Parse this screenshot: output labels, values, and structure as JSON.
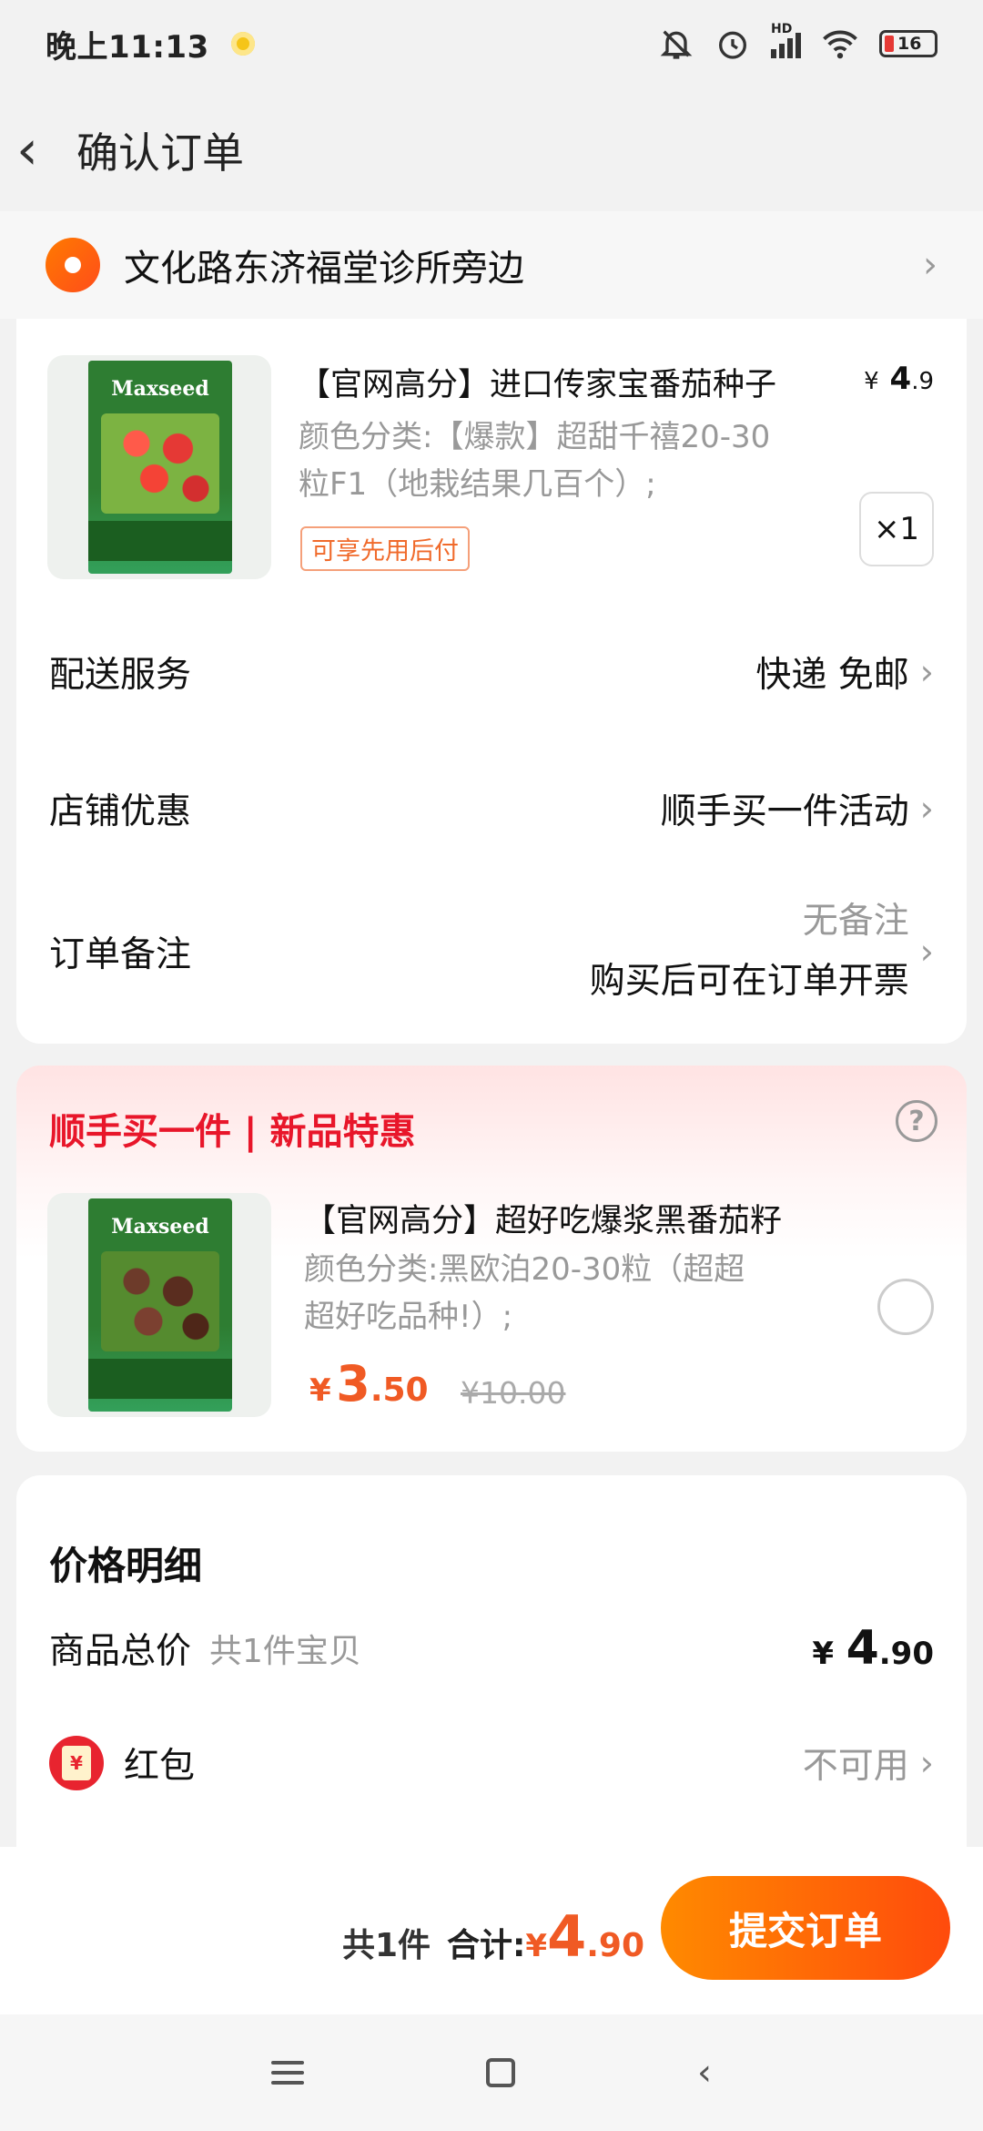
{
  "status": {
    "time": "晚上11:13",
    "network": "HD",
    "battery": "16"
  },
  "nav": {
    "back_icon": "‹",
    "title": "确认订单"
  },
  "address": {
    "text": "文化路东济福堂诊所旁边"
  },
  "order_item": {
    "title": "【官网高分】进口传家宝番茄种子",
    "spec_line1": "颜色分类:【爆款】超甜千禧20-30",
    "spec_line2": "粒F1（地栽结果几百个）;",
    "tag": "可享先用后付",
    "price_cur": "¥",
    "price_int": "4",
    "price_dec": ".9",
    "quantity": "×1",
    "package_brand": "Maxseed"
  },
  "rows": {
    "delivery_label": "配送服务",
    "delivery_value": "快递 免邮",
    "shop_label": "店铺优惠",
    "shop_value": "顺手买一件活动",
    "note_label": "订单备注",
    "note_value1": "无备注",
    "note_value2": "购买后可在订单开票"
  },
  "deal": {
    "header": "顺手买一件 | 新品特惠",
    "help_icon": "?",
    "title": "【官网高分】超好吃爆浆黑番茄籽",
    "spec_line1": "颜色分类:黑欧泊20-30粒（超超",
    "spec_line2": "超好吃品种!）;",
    "price_cur": "¥",
    "price_int": "3",
    "price_dec": ".50",
    "old_price": "¥10.00",
    "package_brand": "Maxseed"
  },
  "detail": {
    "header": "价格明细",
    "goods_label": "商品总价",
    "goods_count": "共1件宝贝",
    "goods_price_cur": "¥",
    "goods_price_int": "4",
    "goods_price_dec": ".90",
    "redpack_label": "红包",
    "redpack_icon_text": "¥",
    "redpack_value": "不可用"
  },
  "bottom": {
    "count": "共1件",
    "total_label": "合计:",
    "total_cur": "¥",
    "total_int": "4",
    "total_dec": ".90",
    "submit": "提交订单"
  },
  "colors": {
    "accent": "#ff5a14",
    "deal_red": "#e8162a",
    "price_orange": "#f05a24"
  }
}
